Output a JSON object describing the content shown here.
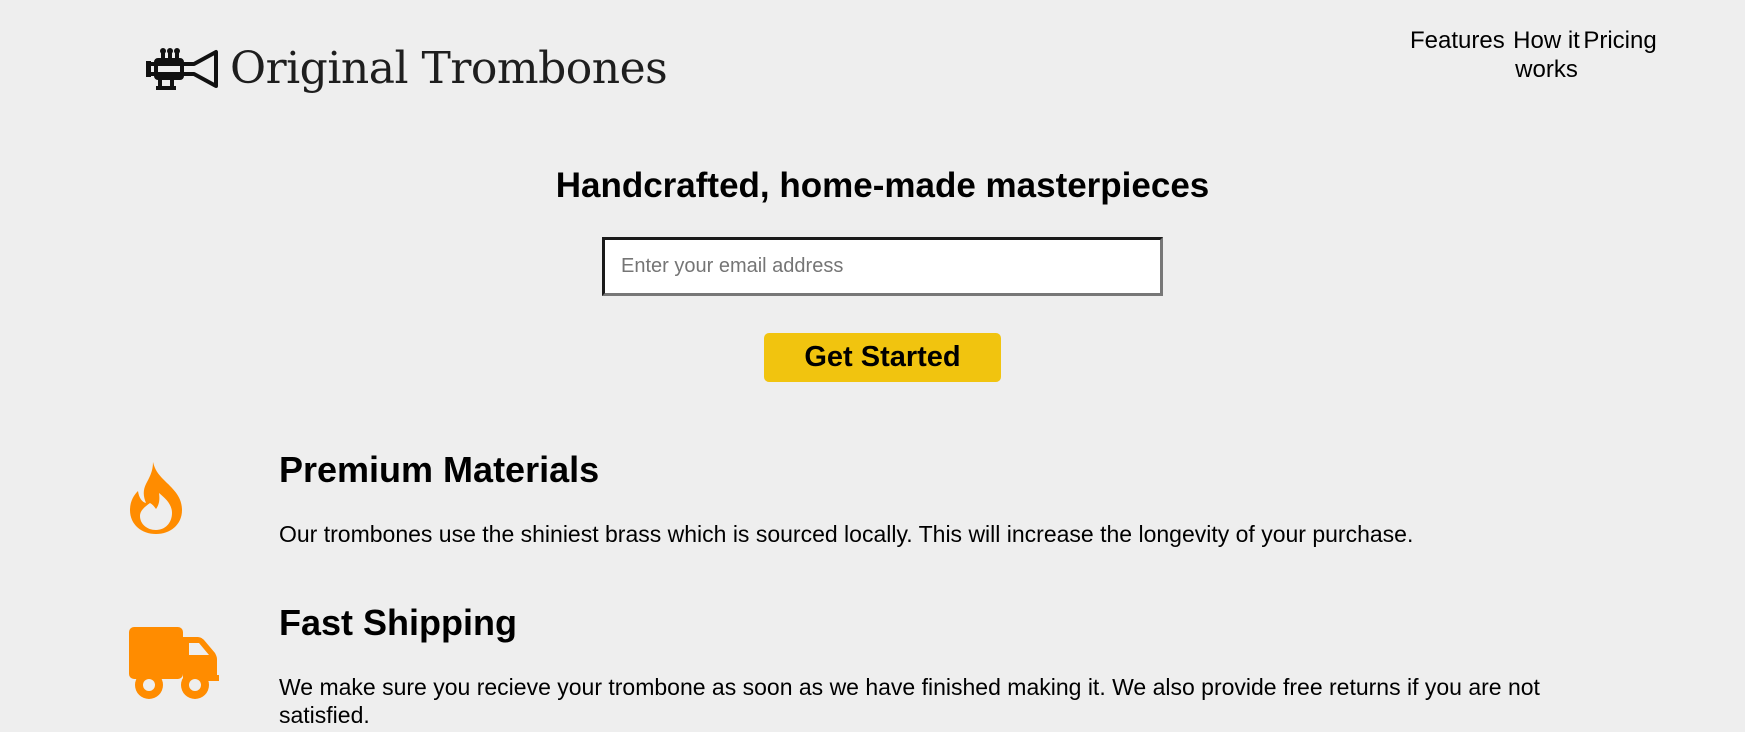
{
  "header": {
    "brand": "Original Trombones",
    "logo_icon": "trombone-icon",
    "nav": [
      {
        "label": "Features"
      },
      {
        "label": "How it works"
      },
      {
        "label": "Pricing"
      }
    ]
  },
  "hero": {
    "title": "Handcrafted, home-made masterpieces",
    "email_placeholder": "Enter your email address",
    "cta_label": "Get Started"
  },
  "features": [
    {
      "icon": "fire-icon",
      "title": "Premium Materials",
      "description": "Our trombones use the shiniest brass which is sourced locally. This will increase the longevity of your purchase."
    },
    {
      "icon": "truck-icon",
      "title": "Fast Shipping",
      "description": "We make sure you recieve your trombone as soon as we have finished making it. We also provide free returns if you are not satisfied."
    }
  ],
  "colors": {
    "background": "#eeeeee",
    "accent": "#f1c40f",
    "icon": "#ff8c00"
  }
}
